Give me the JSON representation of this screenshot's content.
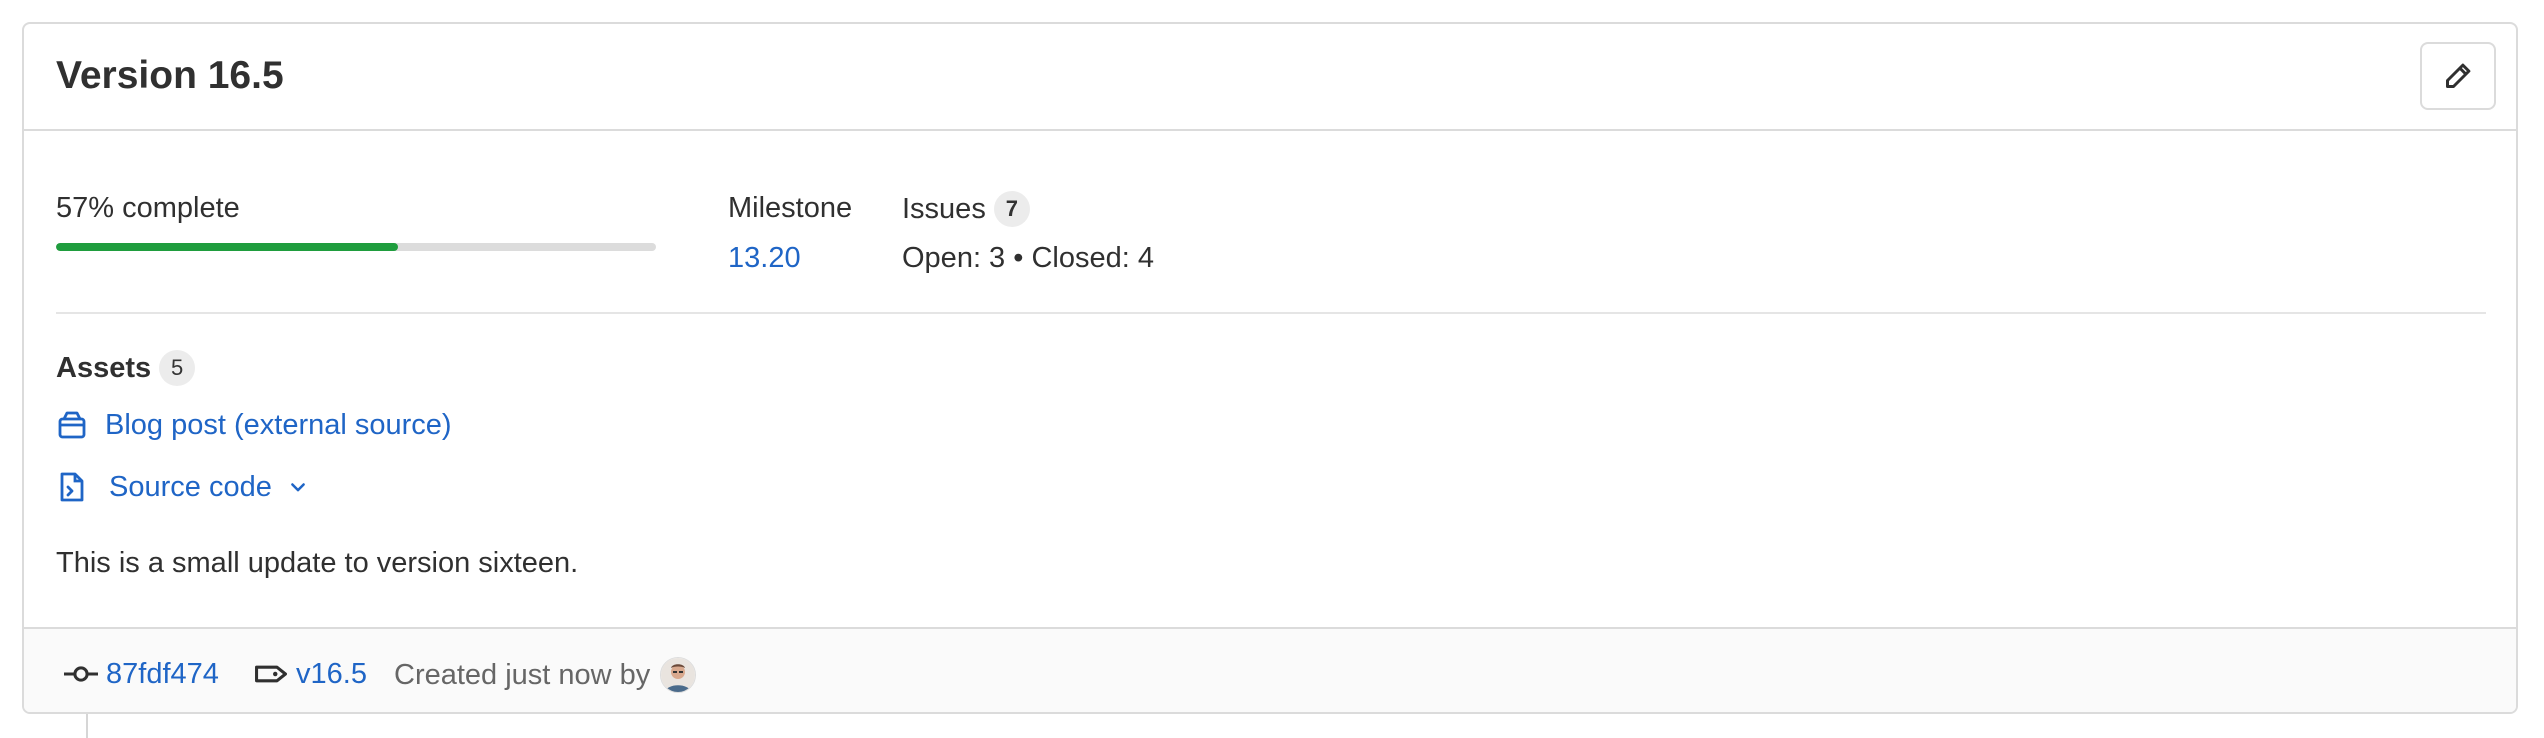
{
  "release": {
    "title": "Version 16.5",
    "edit_icon": "pencil-icon"
  },
  "stats": {
    "progress_label": "57% complete",
    "progress_value": 0.57,
    "milestone_label": "Milestone",
    "milestone_value": "13.20",
    "issues_label": "Issues",
    "issues_count": "7",
    "issues_breakdown": "Open: 3 • Closed: 4"
  },
  "assets": {
    "heading": "Assets",
    "count": "5",
    "items": [
      {
        "label": "Blog post (external source)",
        "icon": "package-icon"
      },
      {
        "label": "Source code",
        "icon": "doc-code-icon",
        "expander_icon": "chevron-down-icon"
      }
    ]
  },
  "description": "This is a small update to version sixteen.",
  "footer": {
    "commit": "87fdf474",
    "commit_icon": "commit-icon",
    "tag": "v16.5",
    "tag_icon": "tag-icon",
    "created_text": "Created just now by"
  },
  "colors": {
    "link": "#1f65c6",
    "progress": "#1f9d3e",
    "border": "#dbdbdb",
    "footer_bg": "#fafafa"
  }
}
